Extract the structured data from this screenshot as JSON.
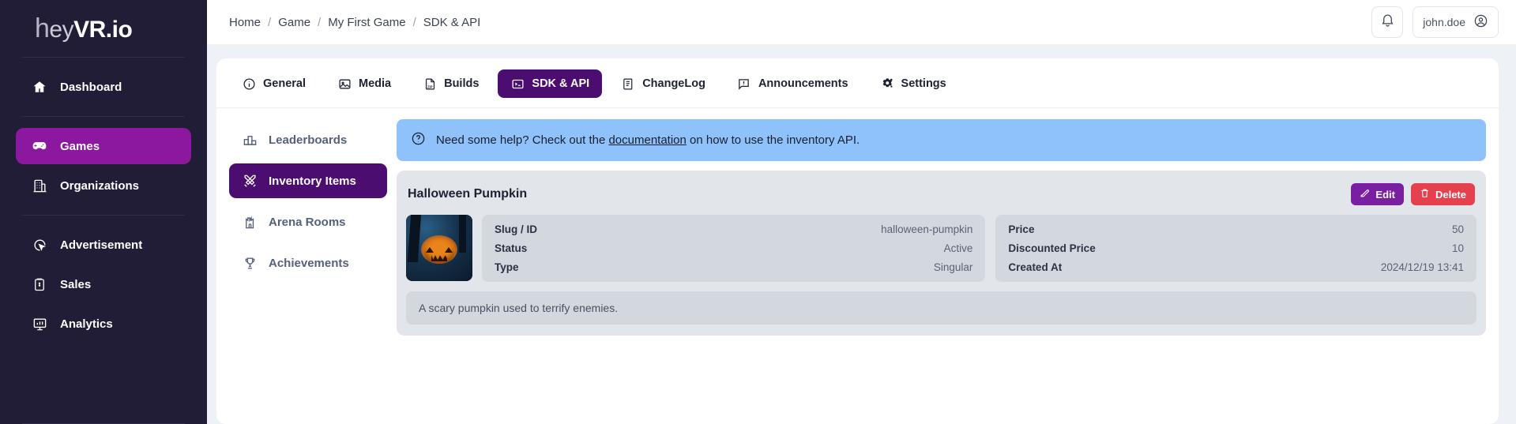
{
  "sidebar": {
    "logo": {
      "h": "h",
      "ey": "ey",
      "vr": "VR.io"
    },
    "groups": [
      {
        "items": [
          {
            "icon": "home-icon",
            "label": "Dashboard",
            "active": false
          }
        ]
      },
      {
        "items": [
          {
            "icon": "gamepad-icon",
            "label": "Games",
            "active": true
          },
          {
            "icon": "building-icon",
            "label": "Organizations",
            "active": false
          }
        ]
      },
      {
        "items": [
          {
            "icon": "ad-cursor-icon",
            "label": "Advertisement",
            "active": false
          },
          {
            "icon": "sales-clipboard-icon",
            "label": "Sales",
            "active": false
          },
          {
            "icon": "analytics-board-icon",
            "label": "Analytics",
            "active": false
          }
        ]
      }
    ]
  },
  "topbar": {
    "breadcrumbs": [
      "Home",
      "Game",
      "My First Game",
      "SDK & API"
    ],
    "separator": "/",
    "notification_icon": "bell-icon",
    "user_name": "john.doe",
    "user_icon": "user-circle-icon"
  },
  "tabs": [
    {
      "icon": "info-circle-icon",
      "label": "General",
      "active": false
    },
    {
      "icon": "image-icon",
      "label": "Media",
      "active": false
    },
    {
      "icon": "zip-file-icon",
      "label": "Builds",
      "active": false
    },
    {
      "icon": "terminal-icon",
      "label": "SDK & API",
      "active": true
    },
    {
      "icon": "scroll-icon",
      "label": "ChangeLog",
      "active": false
    },
    {
      "icon": "announcement-icon",
      "label": "Announcements",
      "active": false
    },
    {
      "icon": "gears-icon",
      "label": "Settings",
      "active": false
    }
  ],
  "subnav": [
    {
      "icon": "podium-icon",
      "label": "Leaderboards",
      "active": false
    },
    {
      "icon": "crossed-swords-icon",
      "label": "Inventory Items",
      "active": true
    },
    {
      "icon": "castle-tower-icon",
      "label": "Arena Rooms",
      "active": false
    },
    {
      "icon": "trophy-icon",
      "label": "Achievements",
      "active": false
    }
  ],
  "banner": {
    "icon": "question-circle-icon",
    "text_before": "Need some help? Check out the ",
    "link": "documentation",
    "text_after": " on how to use the inventory API."
  },
  "item": {
    "title": "Halloween Pumpkin",
    "edit_label": "Edit",
    "edit_icon": "pencil-square-icon",
    "delete_label": "Delete",
    "delete_icon": "trash-icon",
    "thumbnail_alt": "halloween-pumpkin-thumbnail",
    "fields_left": [
      {
        "label": "Slug / ID",
        "value": "halloween-pumpkin"
      },
      {
        "label": "Status",
        "value": "Active"
      },
      {
        "label": "Type",
        "value": "Singular"
      }
    ],
    "fields_right": [
      {
        "label": "Price",
        "value": "50"
      },
      {
        "label": "Discounted Price",
        "value": "10"
      },
      {
        "label": "Created At",
        "value": "2024/12/19 13:41"
      }
    ],
    "description": "A scary pumpkin used to terrify enemies."
  },
  "colors": {
    "sidebar_bg": "#221d36",
    "accent_magenta": "#8b189e",
    "accent_purple": "#4c0d70",
    "banner_blue": "#8fc2fb",
    "edit_purple": "#7b1fa2",
    "delete_red": "#e4404e"
  }
}
